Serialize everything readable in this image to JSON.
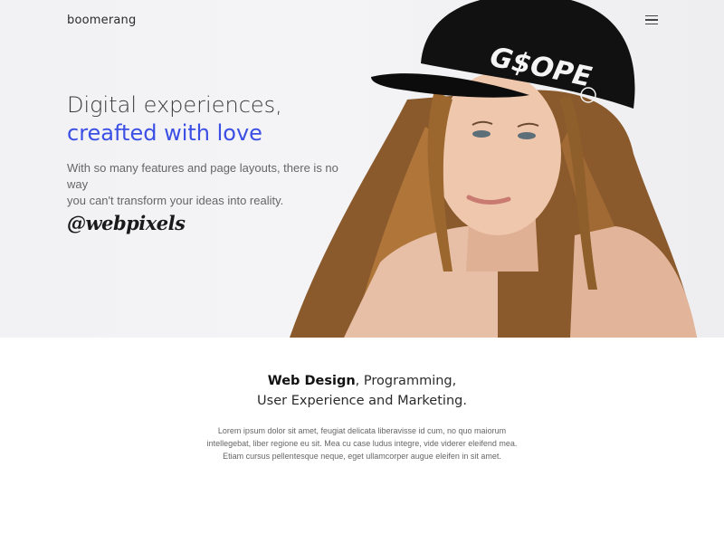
{
  "header": {
    "logo": "boomerang",
    "menu_icon": "hamburger-icon"
  },
  "hero": {
    "headline_line1": "Digital experiences,",
    "headline_line2": "creafted with love",
    "subtext_line1": "With so many features and page layouts, there is no way",
    "subtext_line2": "you can't transform your ideas into reality.",
    "signature": "@webpixels",
    "cap_text": "G$OPE",
    "accent_color": "#3b4fe4"
  },
  "services": {
    "highlight": "Web Design",
    "rest_line1": ", Programming,",
    "line2": "User Experience and Marketing.",
    "body_line1": "Lorem ipsum dolor sit amet, feugiat delicata liberavisse id cum, no quo maiorum",
    "body_line2": "intellegebat, liber regione eu sit. Mea cu case ludus integre, vide viderer eleifend mea.",
    "body_line3": "Etiam cursus pellentesque neque, eget ullamcorper augue eleifen in sit amet."
  }
}
